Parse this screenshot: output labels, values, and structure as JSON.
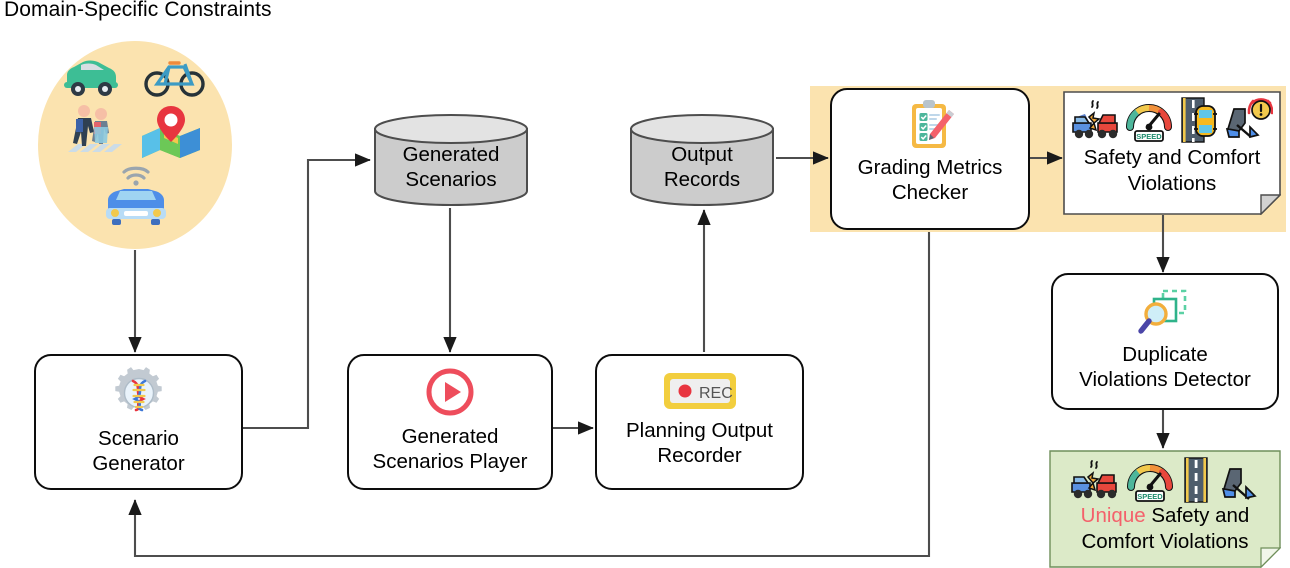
{
  "title": "Domain-Specific Constraints",
  "colors": {
    "highlight_yellow": "#FBE3AF",
    "constraint_circle": "#FBE3AF",
    "result_green": "#DCEAC8",
    "cylinder_fill": "#CCCCCC",
    "node_stroke": "#0D0D0D",
    "edge_stroke": "#4D4D4D",
    "unique_accent": "#F4616B"
  },
  "constraints": {
    "label": "Domain-Specific Constraints",
    "icons": [
      {
        "name": "car-icon",
        "glyph": "car"
      },
      {
        "name": "bicycle-icon",
        "glyph": "bicycle"
      },
      {
        "name": "pedestrians-crosswalk-icon",
        "glyph": "pedestrians"
      },
      {
        "name": "map-pin-icon",
        "glyph": "map"
      },
      {
        "name": "connected-vehicle-icon",
        "glyph": "connected-car"
      }
    ]
  },
  "nodes": {
    "scenario_generator": {
      "line1": "Scenario",
      "line2": "Generator",
      "icon": "gear-dna-icon"
    },
    "generated_scenarios": {
      "line1": "Generated",
      "line2": "Scenarios",
      "shape": "cylinder"
    },
    "generated_scenarios_player": {
      "line1": "Generated",
      "line2": "Scenarios Player",
      "icon": "play-button-icon"
    },
    "planning_output_recorder": {
      "line1": "Planning Output",
      "line2": "Recorder",
      "icon": "rec-badge-icon",
      "icon_label": "REC"
    },
    "output_records": {
      "line1": "Output",
      "line2": "Records",
      "shape": "cylinder"
    },
    "grading_metrics_checker": {
      "line1": "Grading Metrics",
      "line2": "Checker",
      "icon": "clipboard-checklist-pencil-icon"
    },
    "safety_comfort_violations": {
      "line1": "Safety and Comfort",
      "line2": "Violations",
      "icons": [
        {
          "name": "car-collision-icon"
        },
        {
          "name": "speedometer-icon",
          "label": "SPEED"
        },
        {
          "name": "lane-departure-icon"
        },
        {
          "name": "harsh-braking-alert-icon"
        }
      ]
    },
    "duplicate_violations_detector": {
      "line1": "Duplicate",
      "line2": "Violations  Detector",
      "icon": "magnifier-duplicate-icon"
    },
    "unique_safety_comfort_violations": {
      "accent_word": "Unique",
      "line1_rest": " Safety and",
      "line2": "Comfort Violations",
      "icons": [
        {
          "name": "car-collision-icon"
        },
        {
          "name": "speedometer-icon",
          "label": "SPEED"
        },
        {
          "name": "road-lane-icon"
        },
        {
          "name": "harsh-braking-icon"
        }
      ]
    }
  }
}
